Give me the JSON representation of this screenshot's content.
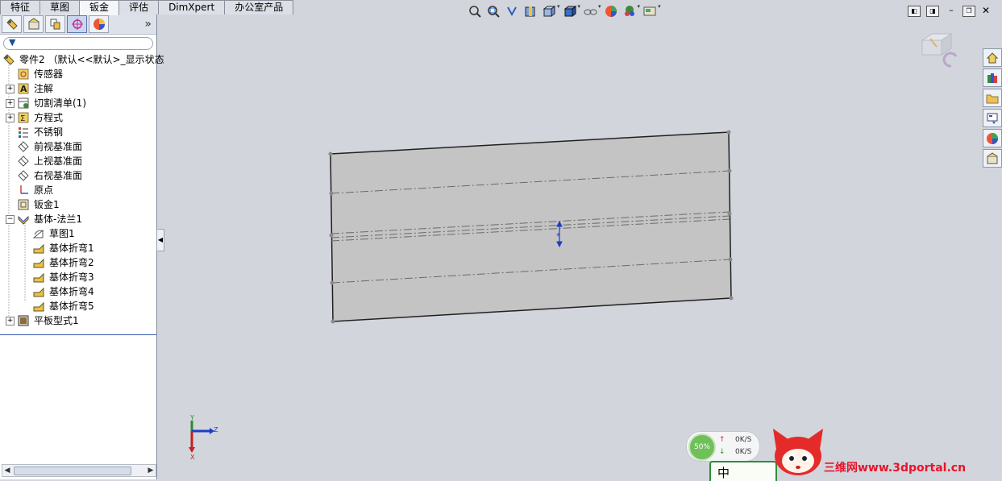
{
  "tabs": [
    {
      "label": "特征",
      "active": false
    },
    {
      "label": "草图",
      "active": false
    },
    {
      "label": "钣金",
      "active": true
    },
    {
      "label": "评估",
      "active": false
    },
    {
      "label": "DimXpert",
      "active": false
    },
    {
      "label": "办公室产品",
      "active": false
    }
  ],
  "panel_toolbar": {
    "icons": [
      "feature-manager-icon",
      "property-manager-icon",
      "configuration-manager-icon",
      "dimxpert-manager-icon",
      "display-manager-icon"
    ],
    "more": "»"
  },
  "filter": {
    "icon": "filter-icon"
  },
  "tree": {
    "root": {
      "label": "零件2 （默认<<默认>_显示状态",
      "icon": "part-icon"
    },
    "items": [
      {
        "label": "传感器",
        "icon": "sensor-icon",
        "expandable": false
      },
      {
        "label": "注解",
        "icon": "annotation-icon",
        "expandable": true
      },
      {
        "label": "切割清单(1)",
        "icon": "cut-list-icon",
        "expandable": true
      },
      {
        "label": "方程式",
        "icon": "equation-icon",
        "expandable": true
      },
      {
        "label": "不锈钢",
        "icon": "material-icon",
        "expandable": false
      },
      {
        "label": "前视基准面",
        "icon": "plane-icon",
        "expandable": false
      },
      {
        "label": "上视基准面",
        "icon": "plane-icon",
        "expandable": false
      },
      {
        "label": "右视基准面",
        "icon": "plane-icon",
        "expandable": false
      },
      {
        "label": "原点",
        "icon": "origin-icon",
        "expandable": false
      },
      {
        "label": "钣金1",
        "icon": "sheet-metal-icon",
        "expandable": false
      },
      {
        "label": "基体-法兰1",
        "icon": "base-flange-icon",
        "expandable": true,
        "expanded": true
      },
      {
        "label": "草图1",
        "icon": "sketch-icon",
        "child": true
      },
      {
        "label": "基体折弯1",
        "icon": "bend-icon",
        "child": true
      },
      {
        "label": "基体折弯2",
        "icon": "bend-icon",
        "child": true
      },
      {
        "label": "基体折弯3",
        "icon": "bend-icon",
        "child": true
      },
      {
        "label": "基体折弯4",
        "icon": "bend-icon",
        "child": true
      },
      {
        "label": "基体折弯5",
        "icon": "bend-icon",
        "child": true
      },
      {
        "label": "平板型式1",
        "icon": "flat-pattern-icon",
        "expandable": true
      }
    ]
  },
  "heads_up_toolbar": [
    "zoom-to-fit-icon",
    "zoom-to-area-icon",
    "previous-view-icon",
    "section-view-icon",
    "view-orientation-icon",
    "display-style-icon",
    "hide-show-items-icon",
    "edit-appearance-icon",
    "apply-scene-icon",
    "view-settings-icon"
  ],
  "task_pane": [
    "solidworks-resources-icon",
    "design-library-icon",
    "file-explorer-icon",
    "view-palette-icon",
    "appearances-icon",
    "custom-properties-icon"
  ],
  "triad": {
    "y": "Y",
    "z": "Z",
    "x": "X"
  },
  "speed": {
    "percent": "50%",
    "up": "0K/S",
    "down": "0K/S"
  },
  "ime": {
    "label": "中"
  },
  "watermark": "三维网www.3dportal.cn"
}
